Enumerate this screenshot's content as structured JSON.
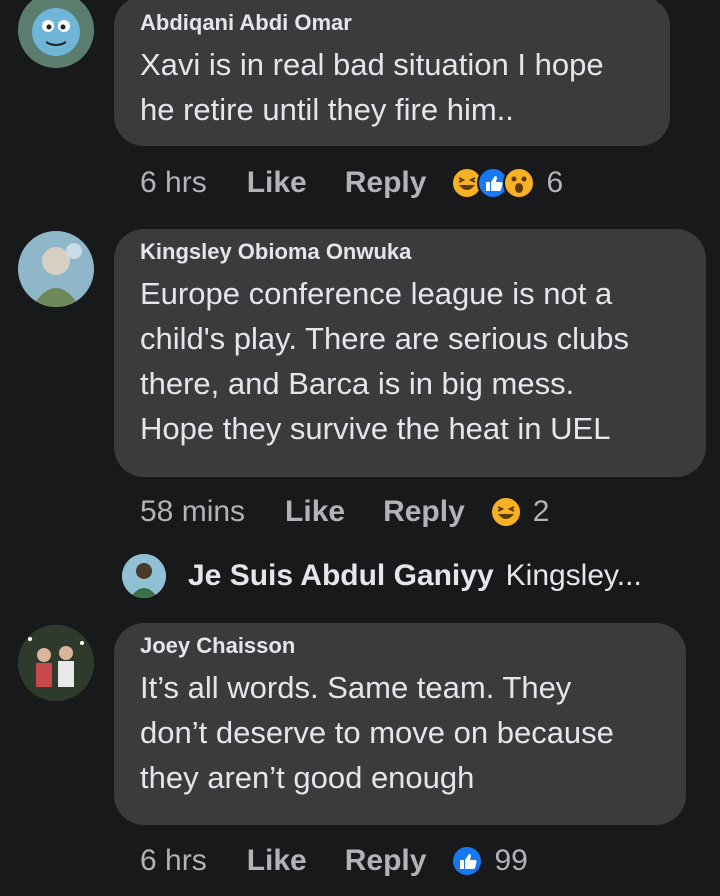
{
  "comments": [
    {
      "author": "Abdiqani Abdi Omar",
      "text_line1": "Xavi is in real bad situation I hope",
      "text_line2": "he retire until they fire him..",
      "time": "6 hrs",
      "like_label": "Like",
      "reply_label": "Reply",
      "reactions": [
        "haha-icon",
        "like-icon",
        "wow-icon"
      ],
      "reaction_count": "6"
    },
    {
      "author": "Kingsley Obioma Onwuka",
      "text_line1": "Europe conference league is not a",
      "text_line2": "child's play. There are serious clubs",
      "text_line3": "there, and Barca is in big mess.",
      "text_line4": "Hope they survive the heat in UEL",
      "time": "58 mins",
      "like_label": "Like",
      "reply_label": "Reply",
      "reactions": [
        "haha-icon"
      ],
      "reaction_count": "2"
    },
    {
      "author": "Joey Chaisson",
      "text_line1": "It’s all words. Same team. They",
      "text_line2": "don’t deserve to move on because",
      "text_line3": "they aren’t good enough",
      "time": "6 hrs",
      "like_label": "Like",
      "reply_label": "Reply",
      "reactions": [
        "like-icon"
      ],
      "reaction_count": "99"
    }
  ],
  "reply_preview": {
    "author": "Je Suis Abdul Ganiyy",
    "text": "Kingsley..."
  },
  "colors": {
    "background": "#18191a",
    "bubble": "#3a3b3c",
    "primary_text": "#e4e6eb",
    "secondary_text": "#b0b3b8",
    "like_blue": "#1877f2",
    "haha_yellow": "#f7b125"
  }
}
